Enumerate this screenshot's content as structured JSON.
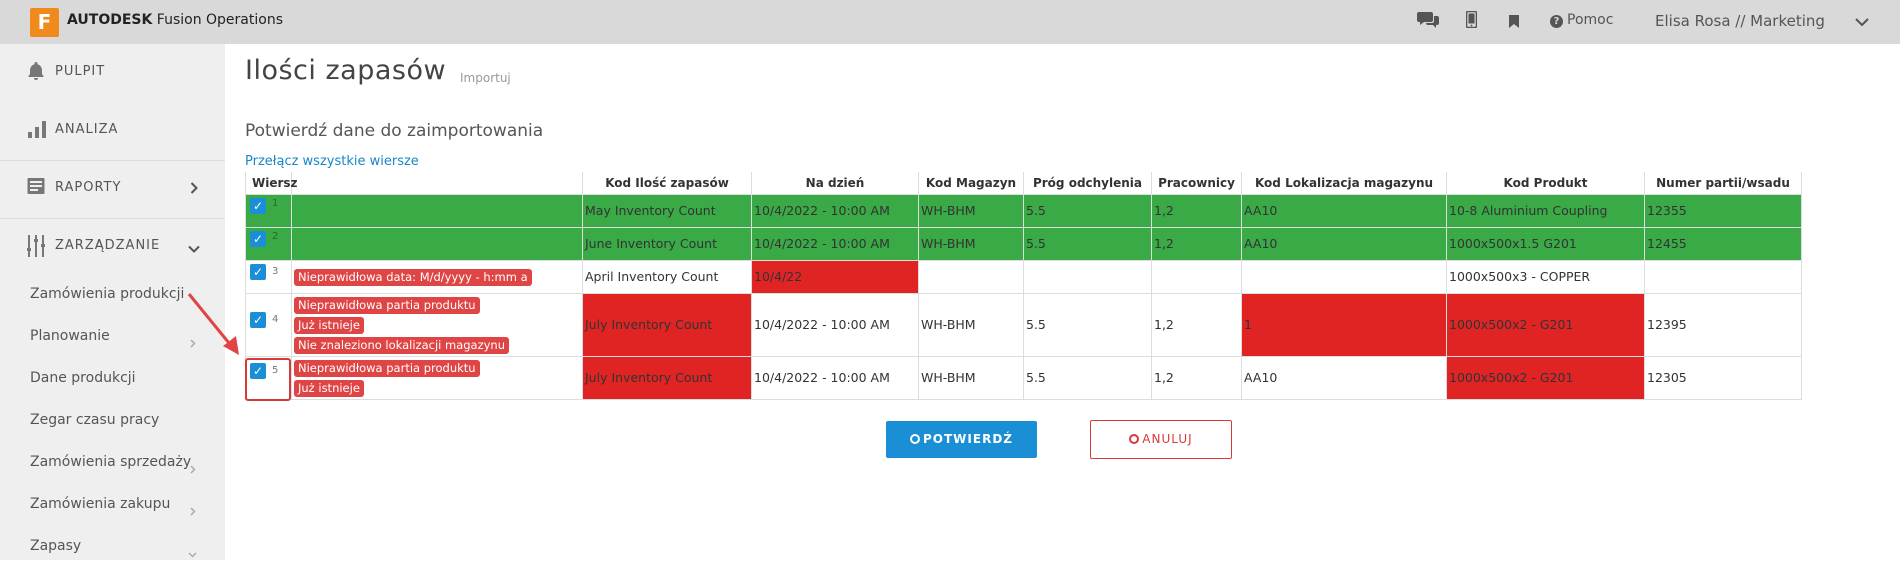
{
  "topbar": {
    "logo_letter": "F",
    "brand_bold": "AUTODESK",
    "brand_rest": " Fusion Operations",
    "help_label": "Pomoc",
    "user_label": "Elisa Rosa // Marketing"
  },
  "sidebar": {
    "main": [
      {
        "label": "PULPIT",
        "icon": "bell-icon"
      },
      {
        "label": "ANALIZA",
        "icon": "bar-chart-icon"
      },
      {
        "label": "RAPORTY",
        "icon": "report-icon"
      },
      {
        "label": "ZARZĄDZANIE",
        "icon": "sliders-icon"
      }
    ],
    "sub": [
      {
        "label": "Zamówienia produkcji"
      },
      {
        "label": "Planowanie"
      },
      {
        "label": "Dane produkcji"
      },
      {
        "label": "Zegar czasu pracy"
      },
      {
        "label": "Zamówienia sprzedaży"
      },
      {
        "label": "Zamówienia zakupu"
      },
      {
        "label": "Zapasy"
      }
    ]
  },
  "page": {
    "title": "Ilości zapasów",
    "import_label": "Importuj",
    "subtitle": "Potwierdź dane do zaimportowania",
    "toggle_label": "Przełącz wszystkie wiersze"
  },
  "table": {
    "headers": [
      "Wiersz",
      "",
      "Kod Ilość zapasów",
      "Na dzień",
      "Kod Magazyn",
      "Próg odchylenia",
      "Pracownicy",
      "Kod Lokalizacja magazynu",
      "Kod Produkt",
      "Numer partii/wsadu"
    ],
    "rows": [
      {
        "num": "1",
        "errors": [],
        "kod": "May Inventory Count",
        "date": "10/4/2022 - 10:00 AM",
        "mag": "WH-BHM",
        "prog": "5.5",
        "prac": "1,2",
        "lok": "AA10",
        "prod": "10-8 Aluminium Coupling",
        "partia": "12355"
      },
      {
        "num": "2",
        "errors": [],
        "kod": "June Inventory Count",
        "date": "10/4/2022 - 10:00 AM",
        "mag": "WH-BHM",
        "prog": "5.5",
        "prac": "1,2",
        "lok": "AA10",
        "prod": "1000x500x1.5 G201",
        "partia": "12455"
      },
      {
        "num": "3",
        "errors": [
          "Nieprawidłowa data: M/d/yyyy - h:mm a"
        ],
        "kod": "April Inventory Count",
        "date": "10/4/22",
        "mag": "",
        "prog": "",
        "prac": "",
        "lok": "",
        "prod": "1000x500x3 - COPPER",
        "partia": ""
      },
      {
        "num": "4",
        "errors": [
          "Nieprawidłowa partia produktu",
          "Już istnieje",
          "Nie znaleziono lokalizacji magazynu"
        ],
        "kod": "July Inventory Count",
        "date": "10/4/2022 - 10:00 AM",
        "mag": "WH-BHM",
        "prog": "5.5",
        "prac": "1,2",
        "lok": "1",
        "prod": "1000x500x2 - G201",
        "partia": "12395"
      },
      {
        "num": "5",
        "errors": [
          "Nieprawidłowa partia produktu",
          "Już istnieje"
        ],
        "kod": "July Inventory Count",
        "date": "10/4/2022 - 10:00 AM",
        "mag": "WH-BHM",
        "prog": "5.5",
        "prac": "1,2",
        "lok": "AA10",
        "prod": "1000x500x2 - G201",
        "partia": "12305"
      }
    ]
  },
  "buttons": {
    "confirm_label": "POTWIERDŹ",
    "cancel_label": "ANULUJ"
  },
  "colors": {
    "valid_row": "#3aaa47",
    "error_cell": "#e02424",
    "error_badge": "#e04545",
    "accent": "#1a8fd6",
    "brand": "#f08a1c"
  }
}
